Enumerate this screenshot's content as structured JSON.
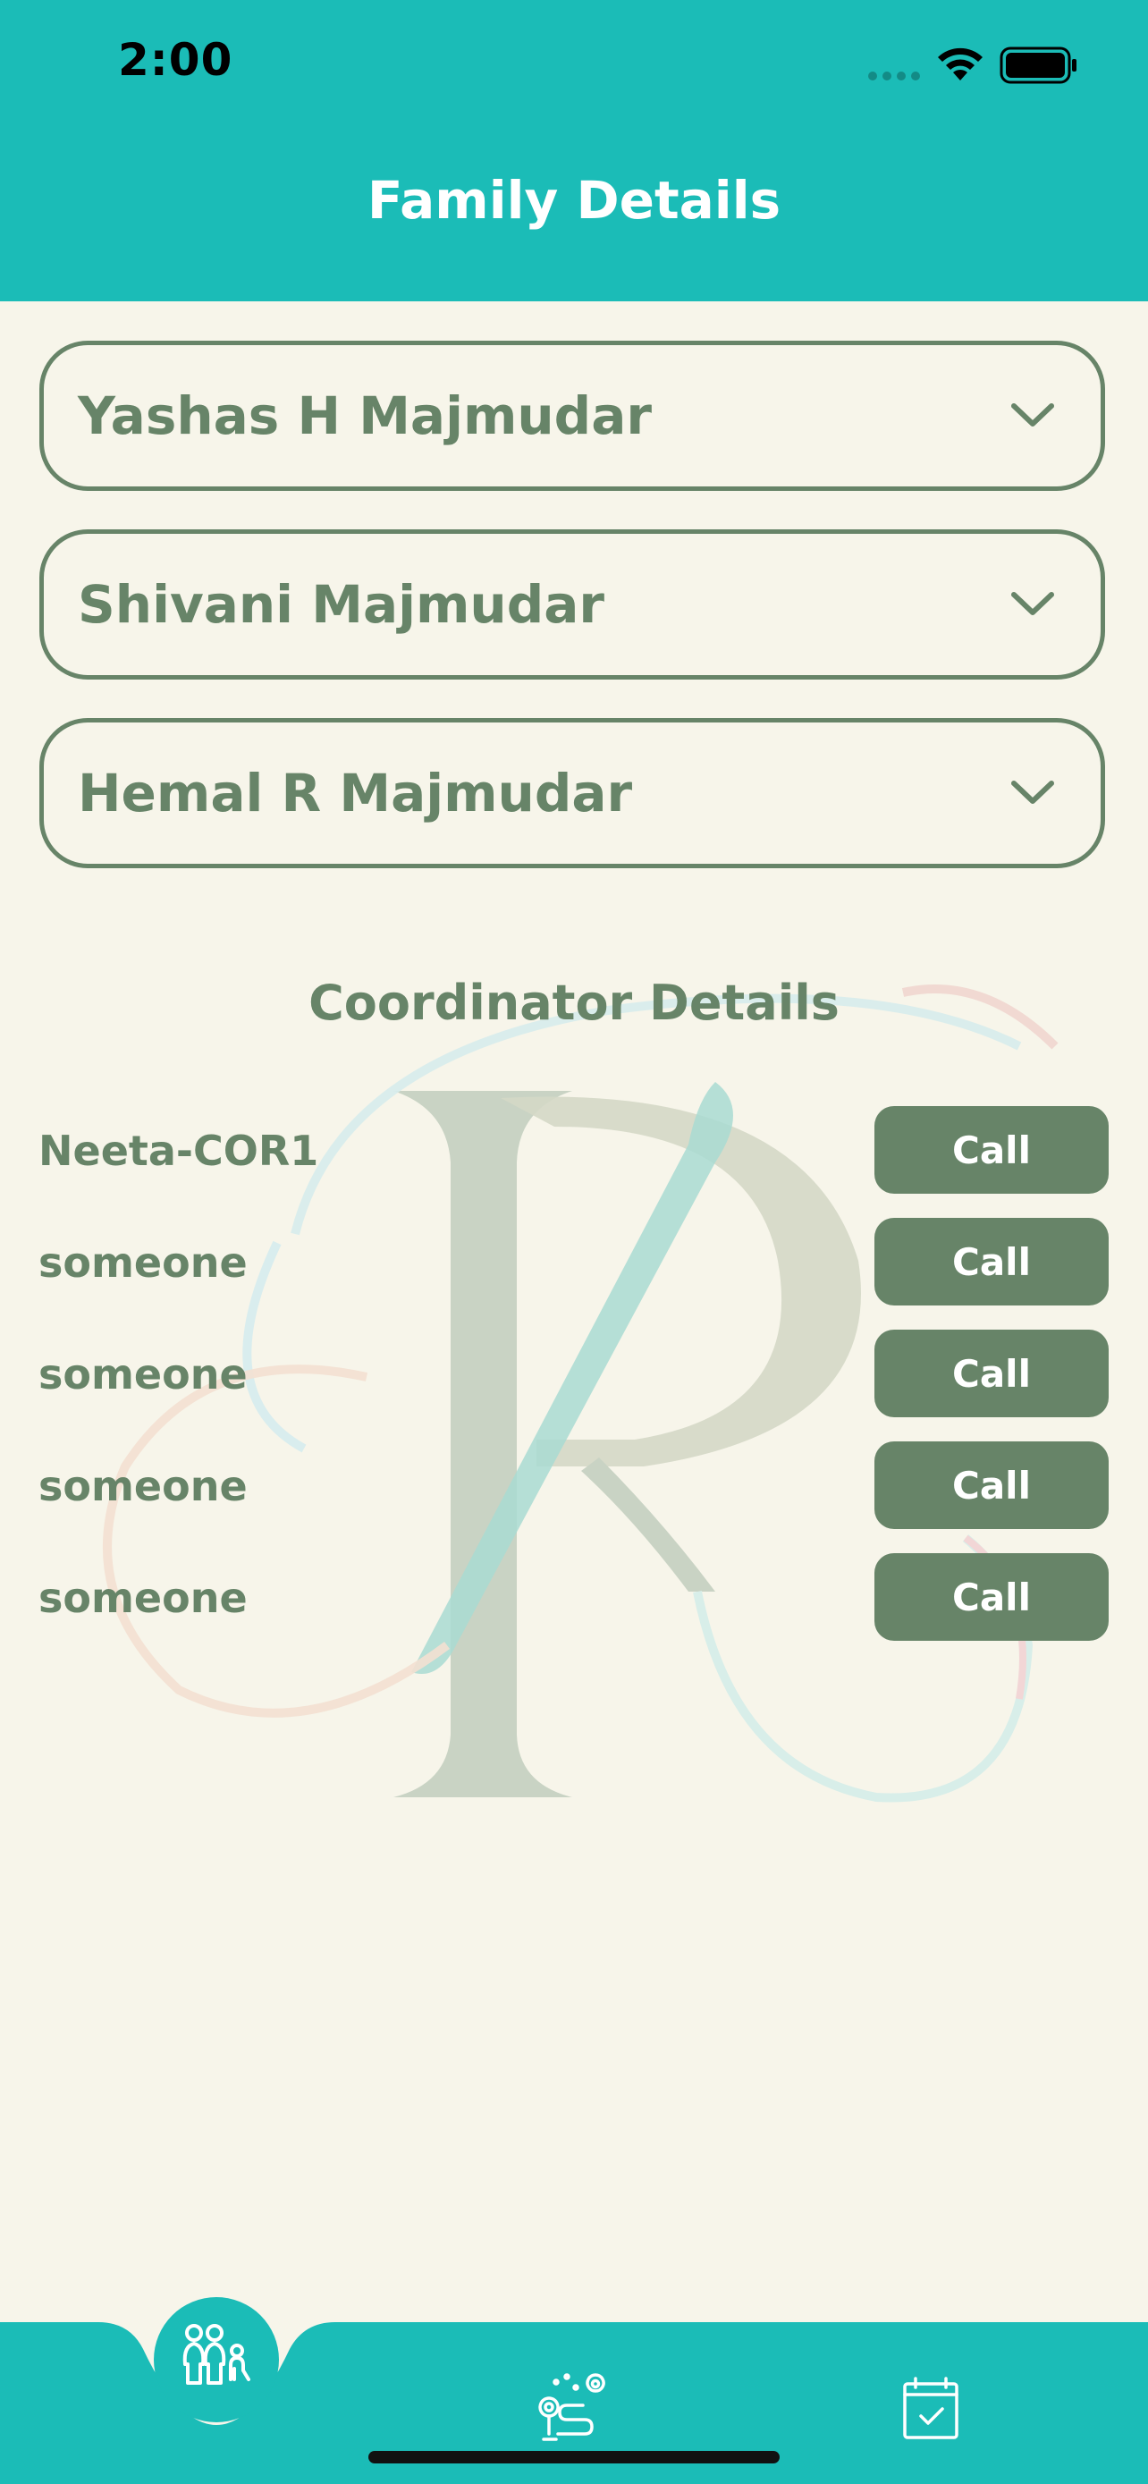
{
  "status_bar": {
    "time": "2:00"
  },
  "header": {
    "title": "Family Details"
  },
  "family_members": [
    {
      "name": "Yashas H Majmudar"
    },
    {
      "name": "Shivani Majmudar"
    },
    {
      "name": "Hemal R Majmudar"
    }
  ],
  "coordinators": {
    "title": "Coordinator Details",
    "call_label": "Call",
    "items": [
      {
        "name": "Neeta-COR1"
      },
      {
        "name": "someone"
      },
      {
        "name": "someone"
      },
      {
        "name": "someone"
      },
      {
        "name": "someone"
      }
    ]
  },
  "tab_bar": {
    "tabs": [
      {
        "icon": "family-icon",
        "active": true
      },
      {
        "icon": "journey-route-icon",
        "active": false
      },
      {
        "icon": "calendar-check-icon",
        "active": false
      }
    ]
  },
  "colors": {
    "teal": "#1BBCB7",
    "green": "#678468",
    "background": "#F7F5EA"
  }
}
